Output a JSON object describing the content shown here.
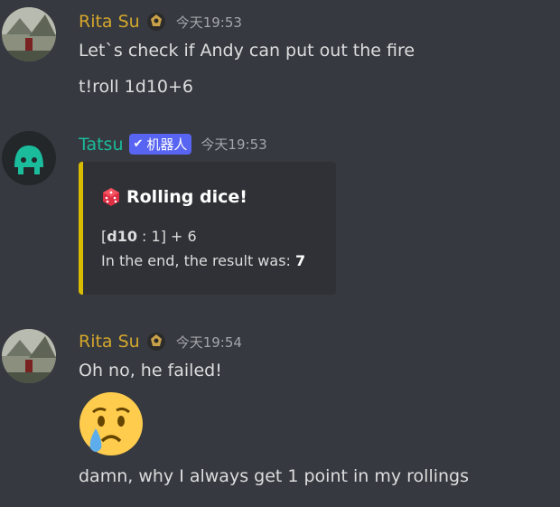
{
  "messages": {
    "m1": {
      "username": "Rita Su",
      "username_color": "#d4a72c",
      "timestamp": "今天19:53",
      "lines": [
        "Let`s check if Andy can put out the fire",
        "t!roll 1d10+6"
      ]
    },
    "m2": {
      "username": "Tatsu",
      "username_color": "#1abc9c",
      "bot_tag": "机器人",
      "timestamp": "今天19:53",
      "embed": {
        "title": "Rolling dice!",
        "dice_open": "[",
        "dice_bold": "d10",
        "dice_rest": " : 1] + 6",
        "result_prefix": "In the end, the result was: ",
        "result_value": "7",
        "accent_color": "#d8bc00"
      }
    },
    "m3": {
      "username": "Rita Su",
      "username_color": "#d4a72c",
      "timestamp": "今天19:54",
      "lines": [
        "Oh no, he failed!",
        "damn, why I always get 1 point in my rollings"
      ],
      "emoji": "crying-face-emoji"
    }
  }
}
